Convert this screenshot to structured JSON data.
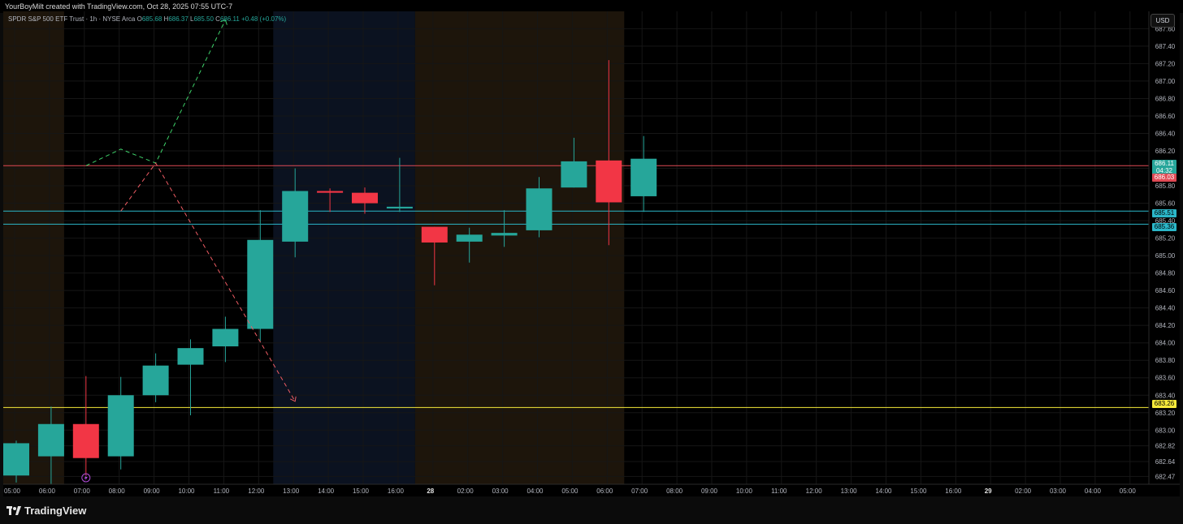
{
  "attribution": "YourBoyMilt created with TradingView.com, Oct 28, 2025 07:55 UTC-7",
  "header": {
    "symbol": "SPDR S&P 500 ETF Trust · 1h · NYSE Arca",
    "open_label": "O",
    "open": "685.68",
    "high_label": "H",
    "high": "686.37",
    "low_label": "L",
    "low": "685.50",
    "close_label": "C",
    "close": "686.11",
    "change": "+0.48 (+0.07%)"
  },
  "currency_button": "USD",
  "brand": "TradingView",
  "price_tags": {
    "last_price": "686.11",
    "countdown": "04:32",
    "red_level": "686.03",
    "cyan_level_1": "685.51",
    "cyan_level_2": "685.36",
    "yellow_level": "683.26"
  },
  "colors": {
    "up": "#26a69a",
    "down": "#f23645",
    "red_line": "#e04a55",
    "cyan_line": "#2bb6c8",
    "yellow_line": "#f5e93a",
    "bull_path": "#3ed26a",
    "bear_path": "#ef5c64",
    "session_orange": "#1d150b",
    "session_blue": "#0b1220"
  },
  "chart_data": {
    "type": "candlestick",
    "ylim": [
      682.38,
      687.78
    ],
    "y_ticks": [
      "687.60",
      "687.40",
      "687.20",
      "687.00",
      "686.80",
      "686.60",
      "686.40",
      "686.20",
      "686.00",
      "685.80",
      "685.60",
      "685.40",
      "685.20",
      "685.00",
      "684.80",
      "684.60",
      "684.40",
      "684.20",
      "684.00",
      "683.80",
      "683.60",
      "683.40",
      "683.20",
      "683.00",
      "682.82",
      "682.64",
      "682.47"
    ],
    "x_ticks": [
      "05:00",
      "06:00",
      "07:00",
      "08:00",
      "09:00",
      "10:00",
      "11:00",
      "12:00",
      "13:00",
      "14:00",
      "15:00",
      "16:00",
      "28",
      "02:00",
      "03:00",
      "04:00",
      "05:00",
      "06:00",
      "07:00",
      "08:00",
      "09:00",
      "10:00",
      "11:00",
      "12:00",
      "13:00",
      "14:00",
      "15:00",
      "16:00",
      "29",
      "02:00",
      "03:00",
      "04:00",
      "05:00"
    ],
    "candles": [
      {
        "time": "05:00",
        "o": 682.48,
        "h": 682.88,
        "l": 682.4,
        "c": 682.85
      },
      {
        "time": "06:00",
        "o": 682.7,
        "h": 683.27,
        "l": 682.38,
        "c": 683.07
      },
      {
        "time": "07:00",
        "o": 683.07,
        "h": 683.62,
        "l": 682.48,
        "c": 682.68
      },
      {
        "time": "08:00",
        "o": 682.7,
        "h": 683.61,
        "l": 682.55,
        "c": 683.4
      },
      {
        "time": "09:00",
        "o": 683.4,
        "h": 683.88,
        "l": 683.32,
        "c": 683.74
      },
      {
        "time": "10:00",
        "o": 683.75,
        "h": 684.04,
        "l": 683.17,
        "c": 683.94
      },
      {
        "time": "11:00",
        "o": 683.96,
        "h": 684.3,
        "l": 683.78,
        "c": 684.16
      },
      {
        "time": "12:00",
        "o": 684.16,
        "h": 685.52,
        "l": 684.02,
        "c": 685.18
      },
      {
        "time": "13:00",
        "o": 685.16,
        "h": 686.0,
        "l": 684.98,
        "c": 685.74
      },
      {
        "time": "14:00",
        "o": 685.74,
        "h": 685.77,
        "l": 685.5,
        "c": 685.72
      },
      {
        "time": "15:00",
        "o": 685.72,
        "h": 685.78,
        "l": 685.48,
        "c": 685.6
      },
      {
        "time": "16:00",
        "o": 685.54,
        "h": 686.12,
        "l": 685.5,
        "c": 685.56
      },
      {
        "time": "28",
        "o": 685.33,
        "h": 685.33,
        "l": 684.66,
        "c": 685.15
      },
      {
        "time": "02:00",
        "o": 685.16,
        "h": 685.32,
        "l": 684.92,
        "c": 685.24
      },
      {
        "time": "03:00",
        "o": 685.23,
        "h": 685.52,
        "l": 685.1,
        "c": 685.26
      },
      {
        "time": "04:00",
        "o": 685.29,
        "h": 685.9,
        "l": 685.21,
        "c": 685.77
      },
      {
        "time": "05:00",
        "o": 685.78,
        "h": 686.35,
        "l": 685.78,
        "c": 686.08
      },
      {
        "time": "06:00",
        "o": 686.09,
        "h": 687.24,
        "l": 685.12,
        "c": 685.61
      },
      {
        "time": "07:00",
        "o": 685.68,
        "h": 686.37,
        "l": 685.5,
        "c": 686.11
      }
    ],
    "horizontal_levels": [
      686.03,
      685.51,
      685.36,
      683.26
    ],
    "bull_projection": [
      [
        "07:00",
        686.03
      ],
      [
        "08:00",
        686.22
      ],
      [
        "09:00",
        686.06
      ],
      [
        "11:00",
        687.7
      ]
    ],
    "bear_projection": [
      [
        "08:00",
        685.51
      ],
      [
        "09:00",
        686.06
      ],
      [
        "13:00",
        683.33
      ]
    ]
  }
}
